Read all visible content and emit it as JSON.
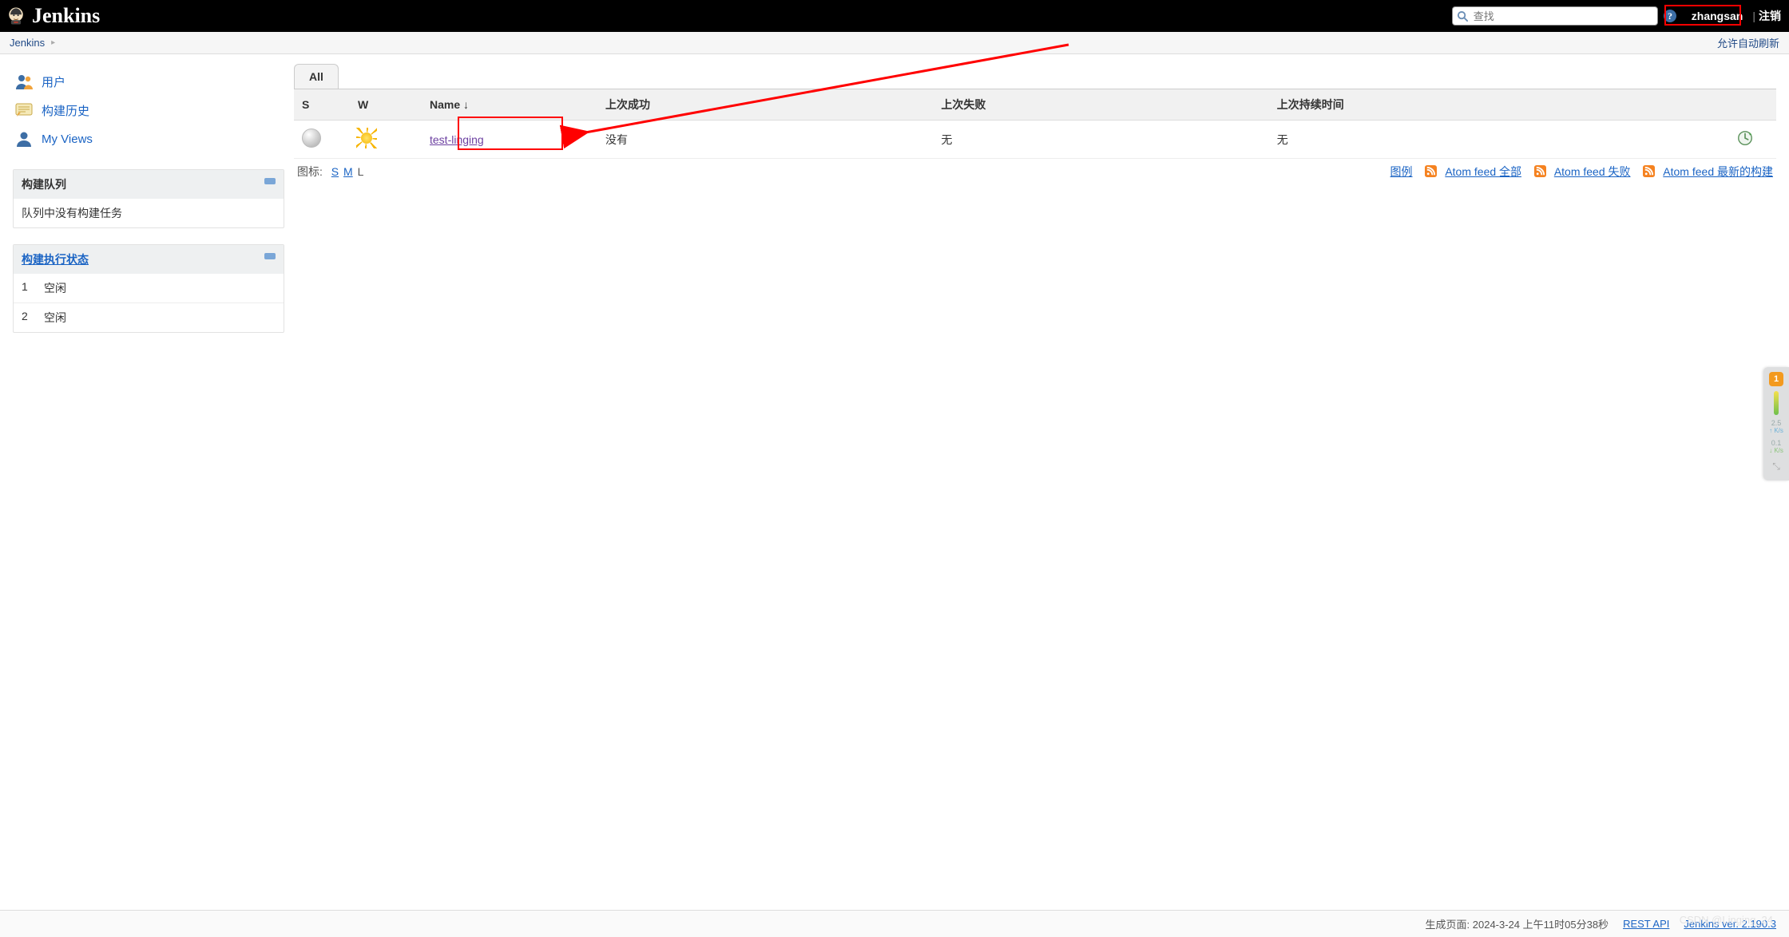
{
  "header": {
    "logo_text": "Jenkins",
    "search_placeholder": "查找",
    "username": "zhangsan",
    "logout_label": "注销",
    "separator": "|"
  },
  "breadcrumb": {
    "items": [
      "Jenkins"
    ],
    "refresh_label": "允许自动刷新"
  },
  "sidebar": {
    "tasks": [
      {
        "label": "用户",
        "icon": "users-icon"
      },
      {
        "label": "构建历史",
        "icon": "history-icon"
      },
      {
        "label": "My Views",
        "icon": "user-icon"
      }
    ],
    "queue": {
      "title": "构建队列",
      "empty_text": "队列中没有构建任务"
    },
    "executors": {
      "title": "构建执行状态",
      "rows": [
        {
          "num": "1",
          "status": "空闲"
        },
        {
          "num": "2",
          "status": "空闲"
        }
      ]
    }
  },
  "main": {
    "tabs": [
      {
        "label": "All"
      }
    ],
    "columns": {
      "s": "S",
      "w": "W",
      "name": "Name  ↓",
      "last_success": "上次成功",
      "last_failure": "上次失败",
      "last_duration": "上次持续时间"
    },
    "jobs": [
      {
        "name": "test-linging",
        "last_success": "没有",
        "last_failure": "无",
        "last_duration": "无"
      }
    ],
    "icon_size": {
      "label": "图标:",
      "s": "S",
      "m": "M",
      "l": "L",
      "current": "L"
    },
    "links": {
      "legend": "图例",
      "rss_all": "Atom feed 全部",
      "rss_fail": "Atom feed 失败",
      "rss_latest": "Atom feed 最新的构建"
    }
  },
  "footer": {
    "generated_label": "生成页面: 2024-3-24 上午11时05分38秒",
    "rest_api": "REST API",
    "version": "Jenkins ver. 2.190.3"
  },
  "floater": {
    "badge": "1",
    "val1": "2.5",
    "unit1": "↑ K/s",
    "val2": "0.1",
    "unit2": "↓ K/s"
  },
  "watermark": "CSDN @Linging_24"
}
